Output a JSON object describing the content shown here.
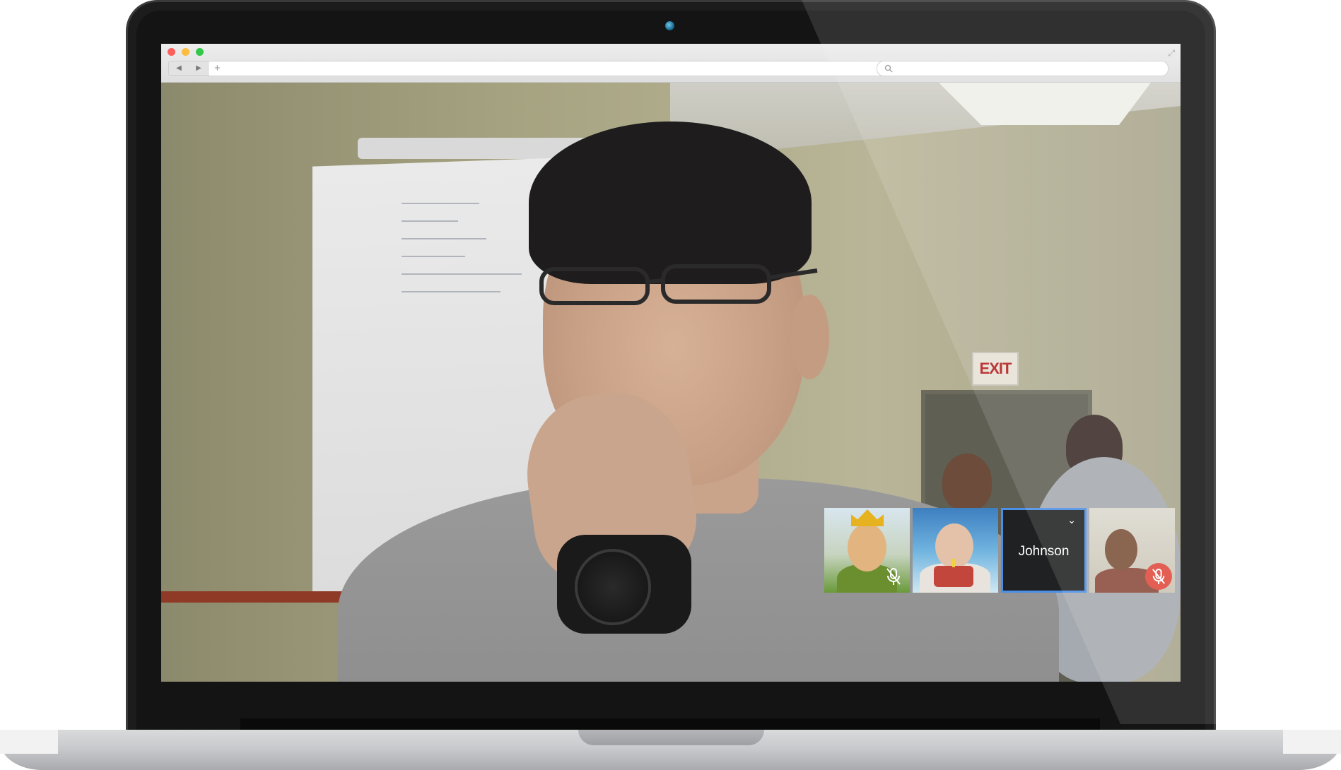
{
  "browser": {
    "nav_back": "◀",
    "nav_forward": "▶",
    "new_tab": "+",
    "address_value": "",
    "search_value": ""
  },
  "call": {
    "main_speaker_icon": "video-feed",
    "exit_sign": "EXIT",
    "participants": [
      {
        "label": "",
        "muted": true,
        "mute_icon": "mic-off-icon"
      },
      {
        "label": "",
        "muted": false
      },
      {
        "label": "Johnson",
        "selected": true,
        "menu_icon": "chevron-down-icon"
      },
      {
        "label": "",
        "muted": true,
        "mute_icon": "mic-off-icon",
        "mute_color": "#e0493d"
      }
    ]
  },
  "colors": {
    "selected_border": "#4a8fe8",
    "mute_badge": "#e0493d",
    "traffic_red": "#fc605c",
    "traffic_yellow": "#fdbc40",
    "traffic_green": "#34c84a"
  }
}
